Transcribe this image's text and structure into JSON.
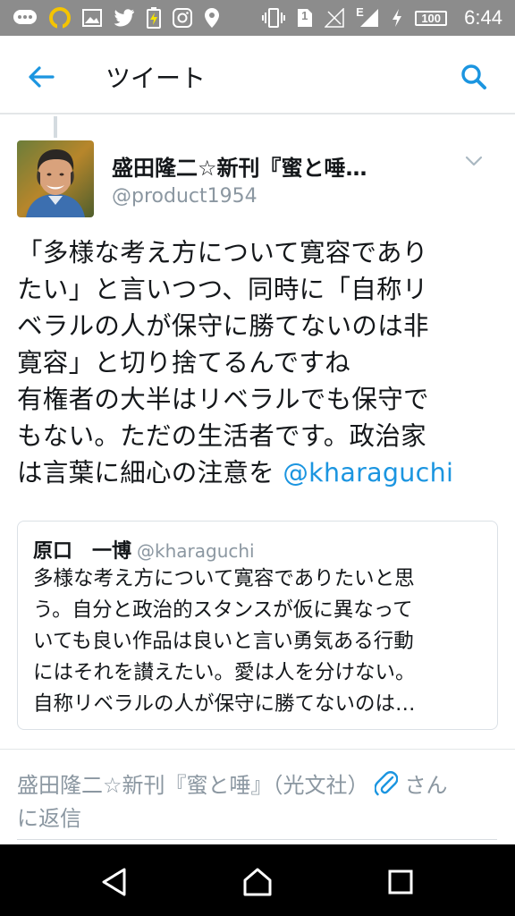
{
  "status_bar": {
    "time": "6:44",
    "battery": "100",
    "sim_slot": "1",
    "network": "E",
    "left_icons": [
      "chat-icon",
      "loop-app-icon",
      "image-icon",
      "twitter-icon",
      "battery-charge-icon",
      "instagram-icon",
      "location-icon"
    ],
    "right_icons": [
      "vibrate-icon",
      "sim-icon",
      "no-signal-icon",
      "signal-e-icon",
      "flash-icon",
      "battery-icon"
    ]
  },
  "app_bar": {
    "title": "ツイート",
    "back_icon": "arrow-left-icon",
    "search_icon": "search-icon",
    "accent_color": "#1b95e0"
  },
  "tweet": {
    "author_name": "盛田隆二☆新刊『蜜と唾…",
    "author_handle": "@product1954",
    "text_lines": [
      "「多様な考え方について寛容であり",
      "たい」と言いつつ、同時に「自称リ",
      "ベラルの人が保守に勝てないのは非",
      "寛容」と切り捨てるんですね",
      "有権者の大半はリベラルでも保守で",
      "もない。ただの生活者です。政治家",
      "は言葉に細心の注意を "
    ],
    "mention": "@kharaguchi",
    "mention_color": "#1b95e0"
  },
  "quoted_tweet": {
    "author_name": "原口　一博",
    "author_handle": "@kharaguchi",
    "text_lines": [
      "多様な考え方について寛容でありたいと思",
      "う。自分と政治的スタンスが仮に異なって",
      "いても良い作品は良いと言い勇気ある行動",
      "にはそれを讃えたい。愛は人を分けない。",
      "自称リベラルの人が保守に勝てないのは…"
    ]
  },
  "reply_bar": {
    "prefix": "盛田隆二☆新刊『蜜と唾』（光文社）",
    "suffix": "さん",
    "line2": "に返信",
    "attach_icon": "paperclip-icon"
  },
  "nav_bar": {
    "buttons": [
      "back-triangle-icon",
      "home-icon",
      "recents-icon"
    ]
  }
}
